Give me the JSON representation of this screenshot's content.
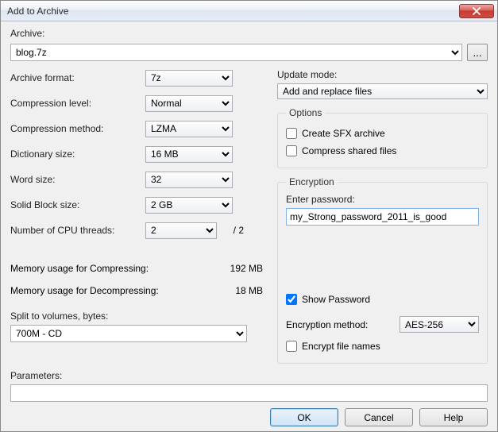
{
  "window": {
    "title": "Add to Archive"
  },
  "archive": {
    "label": "Archive:",
    "value": "blog.7z",
    "browse_label": "..."
  },
  "left": {
    "format_label": "Archive format:",
    "format_value": "7z",
    "level_label": "Compression level:",
    "level_value": "Normal",
    "method_label": "Compression method:",
    "method_value": "LZMA",
    "dict_label": "Dictionary size:",
    "dict_value": "16 MB",
    "word_label": "Word size:",
    "word_value": "32",
    "block_label": "Solid Block size:",
    "block_value": "2 GB",
    "threads_label": "Number of CPU threads:",
    "threads_value": "2",
    "threads_total": "/ 2",
    "mem_compress_label": "Memory usage for Compressing:",
    "mem_compress_value": "192 MB",
    "mem_decompress_label": "Memory usage for Decompressing:",
    "mem_decompress_value": "18 MB",
    "split_label": "Split to volumes, bytes:",
    "split_value": "700M - CD"
  },
  "right": {
    "update_label": "Update mode:",
    "update_value": "Add and replace files",
    "options_legend": "Options",
    "opt_sfx": "Create SFX archive",
    "opt_shared": "Compress shared files",
    "encryption_legend": "Encryption",
    "pw_label": "Enter password:",
    "pw_value": "my_Strong_password_2011_is_good",
    "show_pw": "Show Password",
    "enc_method_label": "Encryption method:",
    "enc_method_value": "AES-256",
    "enc_names": "Encrypt file names"
  },
  "params": {
    "label": "Parameters:",
    "value": ""
  },
  "buttons": {
    "ok": "OK",
    "cancel": "Cancel",
    "help": "Help"
  }
}
